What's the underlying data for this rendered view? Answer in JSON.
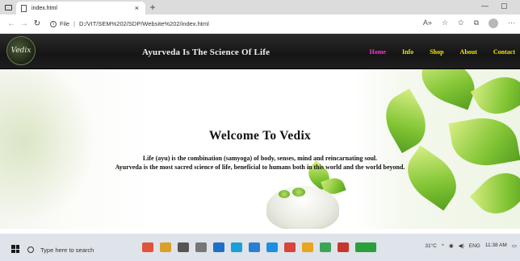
{
  "browser": {
    "tab_title": "index.html",
    "close_tab": "×",
    "new_tab": "+",
    "minimize": "—",
    "maximize": "▢",
    "url_label": "File",
    "url": "D:/VIT/SEM%202/SDP/Website%202/index.html"
  },
  "site": {
    "logo_text": "Vedix",
    "title": "Ayurveda Is The Science Of Life",
    "menu": [
      {
        "label": "Home"
      },
      {
        "label": "Info"
      },
      {
        "label": "Shop"
      },
      {
        "label": "About"
      },
      {
        "label": "Contact"
      }
    ]
  },
  "hero": {
    "heading": "Welcome To Vedix",
    "line1": "Life (ayu) is the combination (samyoga) of body, senses, mind and reincarnating soul.",
    "line2": "Ayurveda is the most sacred science of life, beneficial to humans both in this world and the world beyond."
  },
  "taskbar": {
    "search_placeholder": "Type here to search",
    "weather": "31°C",
    "language": "ENG",
    "time": "11:38 AM"
  },
  "colors": {
    "home_link": "#ff2fd8",
    "menu_link": "#f2e600",
    "header_bg": "#1b1b1b"
  }
}
